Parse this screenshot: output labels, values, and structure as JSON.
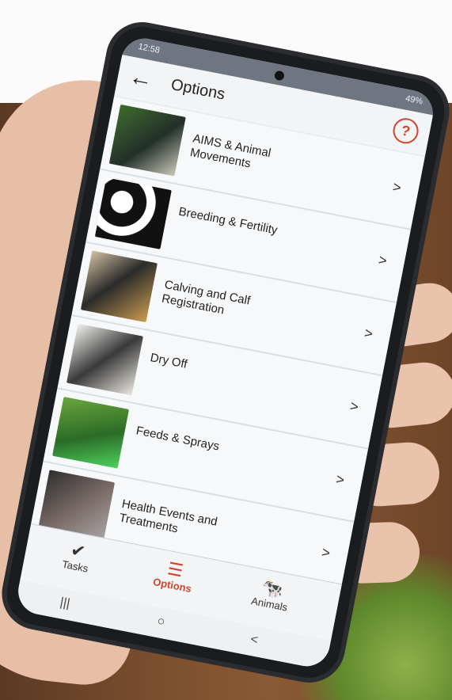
{
  "status": {
    "time": "12:58",
    "battery": "49%"
  },
  "appbar": {
    "back_glyph": "←",
    "title": "Options",
    "help_glyph": "?"
  },
  "list": [
    {
      "label": "AIMS & Animal Movements",
      "chevron": ">"
    },
    {
      "label": "Breeding & Fertility",
      "chevron": ">"
    },
    {
      "label": "Calving and Calf Registration",
      "chevron": ">"
    },
    {
      "label": "Dry Off",
      "chevron": ">"
    },
    {
      "label": "Feeds & Sprays",
      "chevron": ">"
    },
    {
      "label": "Health Events and Treatments",
      "chevron": ">"
    }
  ],
  "nav": {
    "tasks": {
      "label": "Tasks",
      "icon": "✔"
    },
    "options": {
      "label": "Options",
      "icon": "☰"
    },
    "animals": {
      "label": "Animals",
      "icon": "🐄"
    }
  },
  "sysnav": {
    "recent": "|||",
    "home": "○",
    "back": "<"
  },
  "colors": {
    "accent": "#d2452c",
    "screen_bg": "#e9ecef"
  }
}
